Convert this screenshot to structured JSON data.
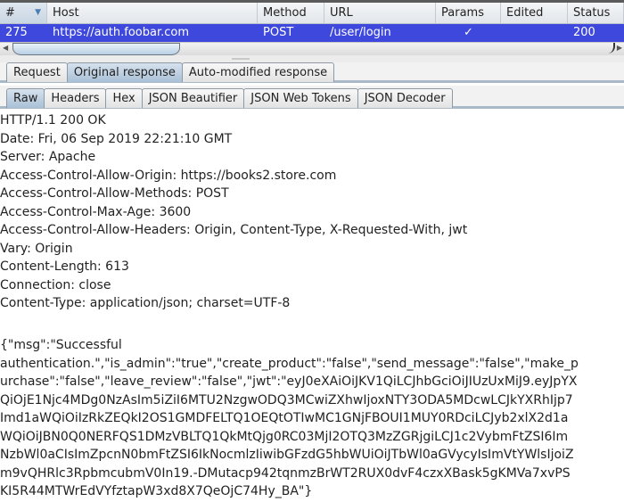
{
  "table": {
    "columns": [
      "#",
      "Host",
      "Method",
      "URL",
      "Params",
      "Edited",
      "Status"
    ],
    "sorted_column": "#",
    "rows": [
      {
        "num": "275",
        "host": "https://auth.foobar.com",
        "method": "POST",
        "url": "/user/login",
        "params": "✓",
        "edited": "",
        "status": "200"
      }
    ],
    "selection_color": "#3f48dc"
  },
  "outer_tabs": {
    "items": [
      "Request",
      "Original response",
      "Auto-modified response"
    ],
    "active": "Original response"
  },
  "inner_tabs": {
    "items": [
      "Raw",
      "Headers",
      "Hex",
      "JSON Beautifier",
      "JSON Web Tokens",
      "JSON Decoder"
    ],
    "active": "Raw"
  },
  "response": {
    "headers": [
      "HTTP/1.1 200 OK",
      "Date: Fri, 06 Sep 2019 22:21:10 GMT",
      "Server: Apache",
      "Access-Control-Allow-Origin: https://books2.store.com",
      "Access-Control-Allow-Methods: POST",
      "Access-Control-Max-Age: 3600",
      "Access-Control-Allow-Headers: Origin, Content-Type, X-Requested-With, jwt",
      "Vary: Origin",
      "Content-Length: 613",
      "Connection: close",
      "Content-Type: application/json; charset=UTF-8"
    ],
    "body_lines": [
      "{\"msg\":\"Successful",
      "authentication.\",\"is_admin\":\"true\",\"create_product\":\"false\",\"send_message\":\"false\",\"make_p",
      "urchase\":\"false\",\"leave_review\":\"false\",\"jwt\":\"eyJ0eXAiOiJKV1QiLCJhbGciOiJIUzUxMiJ9.eyJpYX",
      "QiOjE1Njc4MDg0NzAsIm5iZiI6MTU2NzgwODQ3MCwiZXhwIjoxNTY3ODA5MDcwLCJkYXRhIjp7",
      "Imd1aWQiOiIzRkZEQkI2OS1GMDFELTQ1OEQtOTIwMC1GNjFBOUI1MUY0RDciLCJyb2xlX2d1a",
      "WQiOiJBN0Q0NERFQS1DMzVBLTQ1QkMtQjg0RC03MjI2OTQ3MzZGRjgiLCJ1c2VybmFtZSI6Im",
      "NzbWl0aCIsImZpcnN0bmFtZSI6IkNocmlzIiwibGFzdG5hbWUiOiJTbWl0aGVycyIsImVtYWlsIjoiZ",
      "m9vQHRlc3RpbmcubmV0In19.-DMutacp942tqnmzBrWT2RUX0dvF4czxXBask5gKMVa7xvPS",
      "KI5R44MTWrEdVYfztapW3xd8X7QeOjC74Hy_BA\"}"
    ]
  }
}
